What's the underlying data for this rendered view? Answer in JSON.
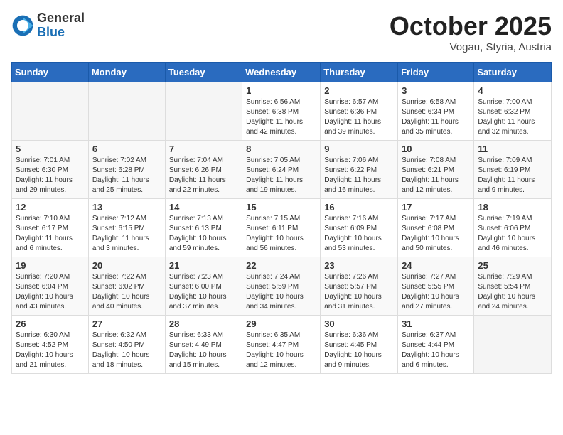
{
  "header": {
    "logo_general": "General",
    "logo_blue": "Blue",
    "month_title": "October 2025",
    "subtitle": "Vogau, Styria, Austria"
  },
  "calendar": {
    "days_of_week": [
      "Sunday",
      "Monday",
      "Tuesday",
      "Wednesday",
      "Thursday",
      "Friday",
      "Saturday"
    ],
    "weeks": [
      [
        {
          "day": "",
          "info": ""
        },
        {
          "day": "",
          "info": ""
        },
        {
          "day": "",
          "info": ""
        },
        {
          "day": "1",
          "info": "Sunrise: 6:56 AM\nSunset: 6:38 PM\nDaylight: 11 hours\nand 42 minutes."
        },
        {
          "day": "2",
          "info": "Sunrise: 6:57 AM\nSunset: 6:36 PM\nDaylight: 11 hours\nand 39 minutes."
        },
        {
          "day": "3",
          "info": "Sunrise: 6:58 AM\nSunset: 6:34 PM\nDaylight: 11 hours\nand 35 minutes."
        },
        {
          "day": "4",
          "info": "Sunrise: 7:00 AM\nSunset: 6:32 PM\nDaylight: 11 hours\nand 32 minutes."
        }
      ],
      [
        {
          "day": "5",
          "info": "Sunrise: 7:01 AM\nSunset: 6:30 PM\nDaylight: 11 hours\nand 29 minutes."
        },
        {
          "day": "6",
          "info": "Sunrise: 7:02 AM\nSunset: 6:28 PM\nDaylight: 11 hours\nand 25 minutes."
        },
        {
          "day": "7",
          "info": "Sunrise: 7:04 AM\nSunset: 6:26 PM\nDaylight: 11 hours\nand 22 minutes."
        },
        {
          "day": "8",
          "info": "Sunrise: 7:05 AM\nSunset: 6:24 PM\nDaylight: 11 hours\nand 19 minutes."
        },
        {
          "day": "9",
          "info": "Sunrise: 7:06 AM\nSunset: 6:22 PM\nDaylight: 11 hours\nand 16 minutes."
        },
        {
          "day": "10",
          "info": "Sunrise: 7:08 AM\nSunset: 6:21 PM\nDaylight: 11 hours\nand 12 minutes."
        },
        {
          "day": "11",
          "info": "Sunrise: 7:09 AM\nSunset: 6:19 PM\nDaylight: 11 hours\nand 9 minutes."
        }
      ],
      [
        {
          "day": "12",
          "info": "Sunrise: 7:10 AM\nSunset: 6:17 PM\nDaylight: 11 hours\nand 6 minutes."
        },
        {
          "day": "13",
          "info": "Sunrise: 7:12 AM\nSunset: 6:15 PM\nDaylight: 11 hours\nand 3 minutes."
        },
        {
          "day": "14",
          "info": "Sunrise: 7:13 AM\nSunset: 6:13 PM\nDaylight: 10 hours\nand 59 minutes."
        },
        {
          "day": "15",
          "info": "Sunrise: 7:15 AM\nSunset: 6:11 PM\nDaylight: 10 hours\nand 56 minutes."
        },
        {
          "day": "16",
          "info": "Sunrise: 7:16 AM\nSunset: 6:09 PM\nDaylight: 10 hours\nand 53 minutes."
        },
        {
          "day": "17",
          "info": "Sunrise: 7:17 AM\nSunset: 6:08 PM\nDaylight: 10 hours\nand 50 minutes."
        },
        {
          "day": "18",
          "info": "Sunrise: 7:19 AM\nSunset: 6:06 PM\nDaylight: 10 hours\nand 46 minutes."
        }
      ],
      [
        {
          "day": "19",
          "info": "Sunrise: 7:20 AM\nSunset: 6:04 PM\nDaylight: 10 hours\nand 43 minutes."
        },
        {
          "day": "20",
          "info": "Sunrise: 7:22 AM\nSunset: 6:02 PM\nDaylight: 10 hours\nand 40 minutes."
        },
        {
          "day": "21",
          "info": "Sunrise: 7:23 AM\nSunset: 6:00 PM\nDaylight: 10 hours\nand 37 minutes."
        },
        {
          "day": "22",
          "info": "Sunrise: 7:24 AM\nSunset: 5:59 PM\nDaylight: 10 hours\nand 34 minutes."
        },
        {
          "day": "23",
          "info": "Sunrise: 7:26 AM\nSunset: 5:57 PM\nDaylight: 10 hours\nand 31 minutes."
        },
        {
          "day": "24",
          "info": "Sunrise: 7:27 AM\nSunset: 5:55 PM\nDaylight: 10 hours\nand 27 minutes."
        },
        {
          "day": "25",
          "info": "Sunrise: 7:29 AM\nSunset: 5:54 PM\nDaylight: 10 hours\nand 24 minutes."
        }
      ],
      [
        {
          "day": "26",
          "info": "Sunrise: 6:30 AM\nSunset: 4:52 PM\nDaylight: 10 hours\nand 21 minutes."
        },
        {
          "day": "27",
          "info": "Sunrise: 6:32 AM\nSunset: 4:50 PM\nDaylight: 10 hours\nand 18 minutes."
        },
        {
          "day": "28",
          "info": "Sunrise: 6:33 AM\nSunset: 4:49 PM\nDaylight: 10 hours\nand 15 minutes."
        },
        {
          "day": "29",
          "info": "Sunrise: 6:35 AM\nSunset: 4:47 PM\nDaylight: 10 hours\nand 12 minutes."
        },
        {
          "day": "30",
          "info": "Sunrise: 6:36 AM\nSunset: 4:45 PM\nDaylight: 10 hours\nand 9 minutes."
        },
        {
          "day": "31",
          "info": "Sunrise: 6:37 AM\nSunset: 4:44 PM\nDaylight: 10 hours\nand 6 minutes."
        },
        {
          "day": "",
          "info": ""
        }
      ]
    ]
  }
}
